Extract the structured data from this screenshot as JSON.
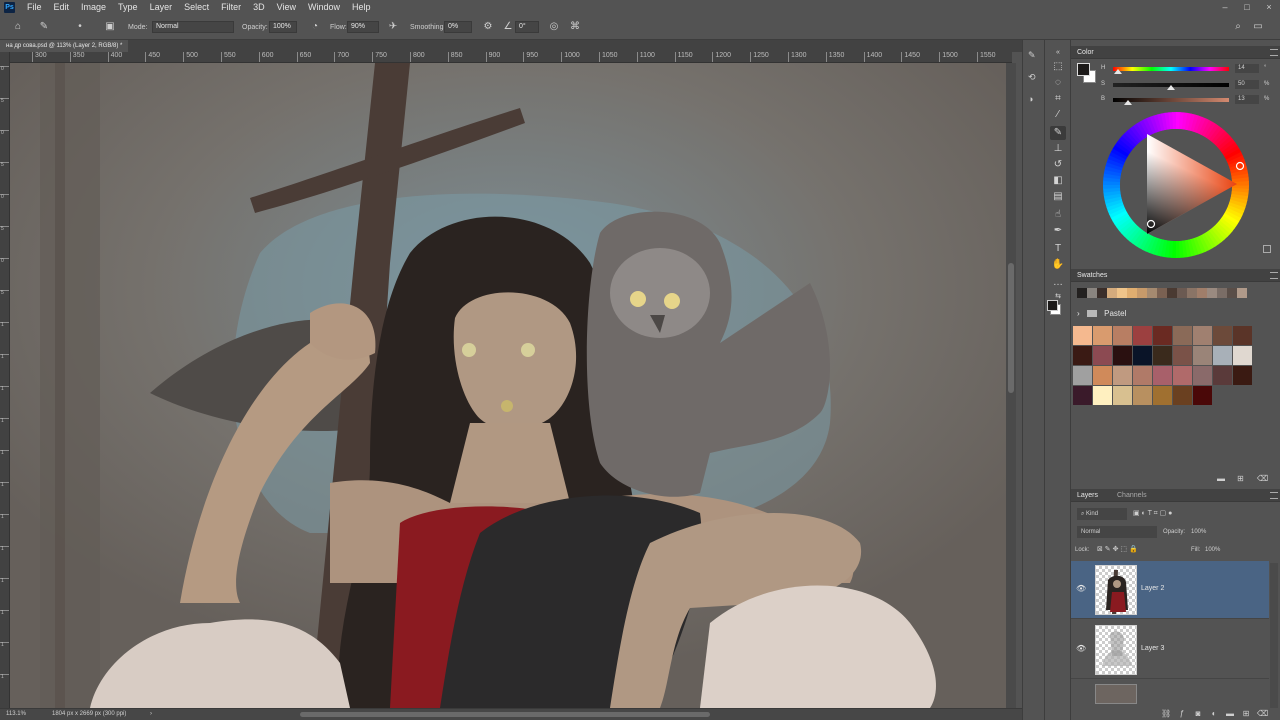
{
  "app": {
    "logo": "Ps"
  },
  "menu": [
    "File",
    "Edit",
    "Image",
    "Type",
    "Layer",
    "Select",
    "Filter",
    "3D",
    "View",
    "Window",
    "Help"
  ],
  "window_controls": [
    "–",
    "□",
    "×"
  ],
  "options": {
    "mode_label": "Mode:",
    "mode_value": "Normal",
    "opacity_label": "Opacity:",
    "opacity_value": "100%",
    "flow_label": "Flow:",
    "flow_value": "90%",
    "smoothing_label": "Smoothing:",
    "smoothing_value": "0%",
    "angle_value": "0°"
  },
  "document": {
    "tab_title": "на др сова.psd @ 113% (Layer 2, RGB/8) *"
  },
  "ruler_top": [
    "300",
    "350",
    "400",
    "450",
    "500",
    "550",
    "600",
    "650",
    "700",
    "750",
    "800",
    "850",
    "900",
    "950",
    "1000",
    "1050",
    "1100",
    "1150",
    "1200",
    "1250",
    "1300",
    "1350",
    "1400",
    "1450",
    "1500",
    "1550"
  ],
  "ruler_left": [
    "0",
    "5",
    "0",
    "5",
    "0",
    "5",
    "0",
    "5",
    "1",
    "1",
    "1",
    "1",
    "1",
    "1",
    "1",
    "1",
    "1",
    "1",
    "1",
    "1"
  ],
  "status": {
    "zoom": "113.1%",
    "doc_size": "1804 px x 2669 px (300 ppi)"
  },
  "color_panel": {
    "tab": "Color",
    "foreground": "#1c1a19",
    "background": "#ffffff",
    "sliders": [
      {
        "label": "H",
        "value": "14",
        "unit": "°",
        "position": 0.04
      },
      {
        "label": "S",
        "value": "50",
        "unit": "%",
        "position": 0.5
      },
      {
        "label": "B",
        "value": "13",
        "unit": "%",
        "position": 0.13
      }
    ]
  },
  "swatches_panel": {
    "tab": "Swatches",
    "recent": [
      "#232120",
      "#8a8580",
      "#3a2e2a",
      "#d4ab7d",
      "#efc48a",
      "#e0ae70",
      "#c79a6a",
      "#a58a70",
      "#7a6152",
      "#4a3a32",
      "#6b5a52",
      "#8a7466",
      "#a07e6a",
      "#9a8a80",
      "#7a6d66",
      "#5a4e48",
      "#b09a8a"
    ],
    "group_name": "Pastel",
    "colors": [
      "#f5b98f",
      "#d99b6e",
      "#b87e63",
      "#9c4040",
      "#6a2a22",
      "#8a6a58",
      "#a08070",
      "#6c4a3a",
      "#5a3428",
      "#3a1a14",
      "#8c4a52",
      "#2a1010",
      "#0a1428",
      "#3a2a1c",
      "#7a5248",
      "#9a8478",
      "#a8b0b8",
      "#e0d8d0",
      "#a0a0a0",
      "#d08a5a",
      "#c09a80",
      "#b07a68",
      "#a8606a",
      "#b06a6a",
      "#8a6a6a",
      "#5a3a3a",
      "#3a1a12",
      "#3a1a2a",
      "#fff0c0",
      "#d8c090",
      "#b89060",
      "#a07030",
      "#6a4020",
      "#4a0808"
    ]
  },
  "layers_panel": {
    "tabs": [
      "Layers",
      "Channels"
    ],
    "filter": "Kind",
    "blend_mode": "Normal",
    "opacity_label": "Opacity:",
    "opacity_value": "100%",
    "lock_label": "Lock:",
    "fill_label": "Fill:",
    "fill_value": "100%",
    "layers": [
      {
        "name": "Layer 2",
        "visible": true,
        "selected": true
      },
      {
        "name": "Layer 3",
        "visible": true,
        "selected": false
      }
    ]
  }
}
